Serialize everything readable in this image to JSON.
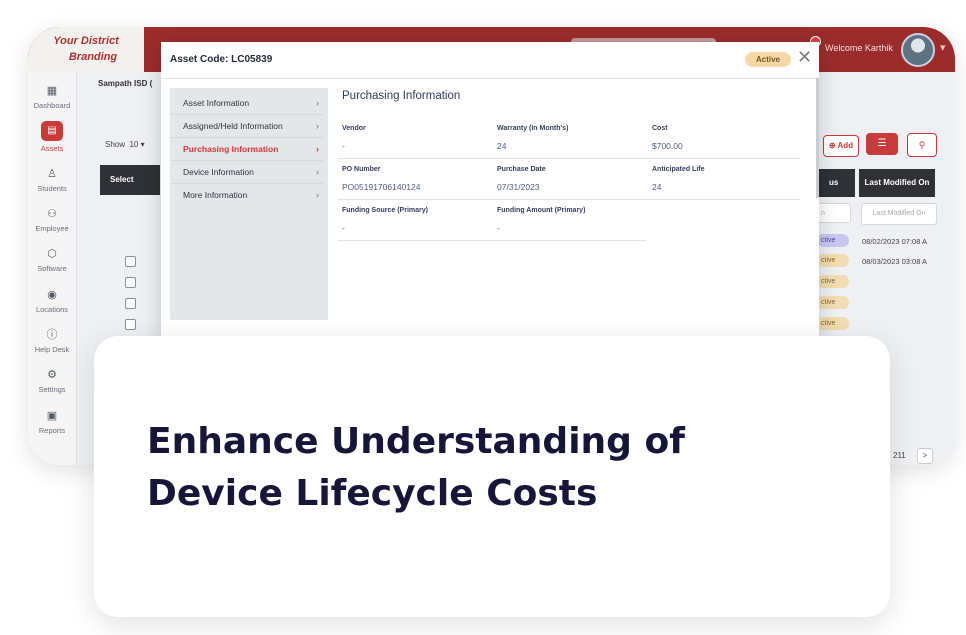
{
  "app": {
    "brand_line1": "Your District",
    "brand_line2": "Branding",
    "welcome": "Welcome Karthik",
    "district": "Sampath ISD (",
    "colors": {
      "primary": "#c93a3a",
      "topbar": "#9c2c2c",
      "active_badge": "#f7d9a8"
    }
  },
  "sidebar": {
    "items": [
      {
        "label": "Dashboard",
        "icon": "dashboard-icon"
      },
      {
        "label": "Assets",
        "icon": "assets-icon",
        "active": true
      },
      {
        "label": "Students",
        "icon": "students-icon"
      },
      {
        "label": "Employee",
        "icon": "employee-icon"
      },
      {
        "label": "Software",
        "icon": "software-icon"
      },
      {
        "label": "Locations",
        "icon": "location-pin-icon"
      },
      {
        "label": "Help Desk",
        "icon": "info-icon"
      },
      {
        "label": "Settings",
        "icon": "gear-icon"
      },
      {
        "label": "Reports",
        "icon": "report-icon"
      }
    ]
  },
  "list": {
    "show_label": "Show",
    "page_size": "10",
    "select_header": "Select",
    "add_label": "Add",
    "status_header": "us",
    "last_modified_header": "Last Modified On",
    "filter_status_placeholder": "n",
    "filter_lmo_placeholder": "Last Modified On",
    "rows": [
      {
        "status": "ctive",
        "last_modified": "08/02/2023 07:08 A"
      },
      {
        "status": "ctive",
        "last_modified": "08/03/2023 03:08 A"
      },
      {
        "status": "ctive",
        "last_modified": ""
      },
      {
        "status": "ctive",
        "last_modified": ""
      },
      {
        "status": "ctive",
        "last_modified": ""
      }
    ],
    "pager_text": "211",
    "pager_next": ">"
  },
  "modal": {
    "title": "Asset Code: LC05839",
    "status": "Active",
    "close": "✕",
    "nav": [
      {
        "label": "Asset Information"
      },
      {
        "label": "Assigned/Held Information"
      },
      {
        "label": "Purchasing Information",
        "active": true
      },
      {
        "label": "Device Information"
      },
      {
        "label": "More Information"
      }
    ],
    "section_title": "Purchasing Information",
    "fields": [
      {
        "label": "Vendor",
        "value": "-"
      },
      {
        "label": "Warranty (In Month's)",
        "value": "24"
      },
      {
        "label": "Cost",
        "value": "$700.00"
      },
      {
        "label": "PO Number",
        "value": "PO05191706140124"
      },
      {
        "label": "Purchase Date",
        "value": "07/31/2023"
      },
      {
        "label": "Anticipated Life",
        "value": "24"
      },
      {
        "label": "Funding Source (Primary)",
        "value": "-"
      },
      {
        "label": "Funding Amount (Primary)",
        "value": "-"
      }
    ]
  },
  "card": {
    "heading": "Enhance Understanding of Device Lifecycle Costs"
  }
}
